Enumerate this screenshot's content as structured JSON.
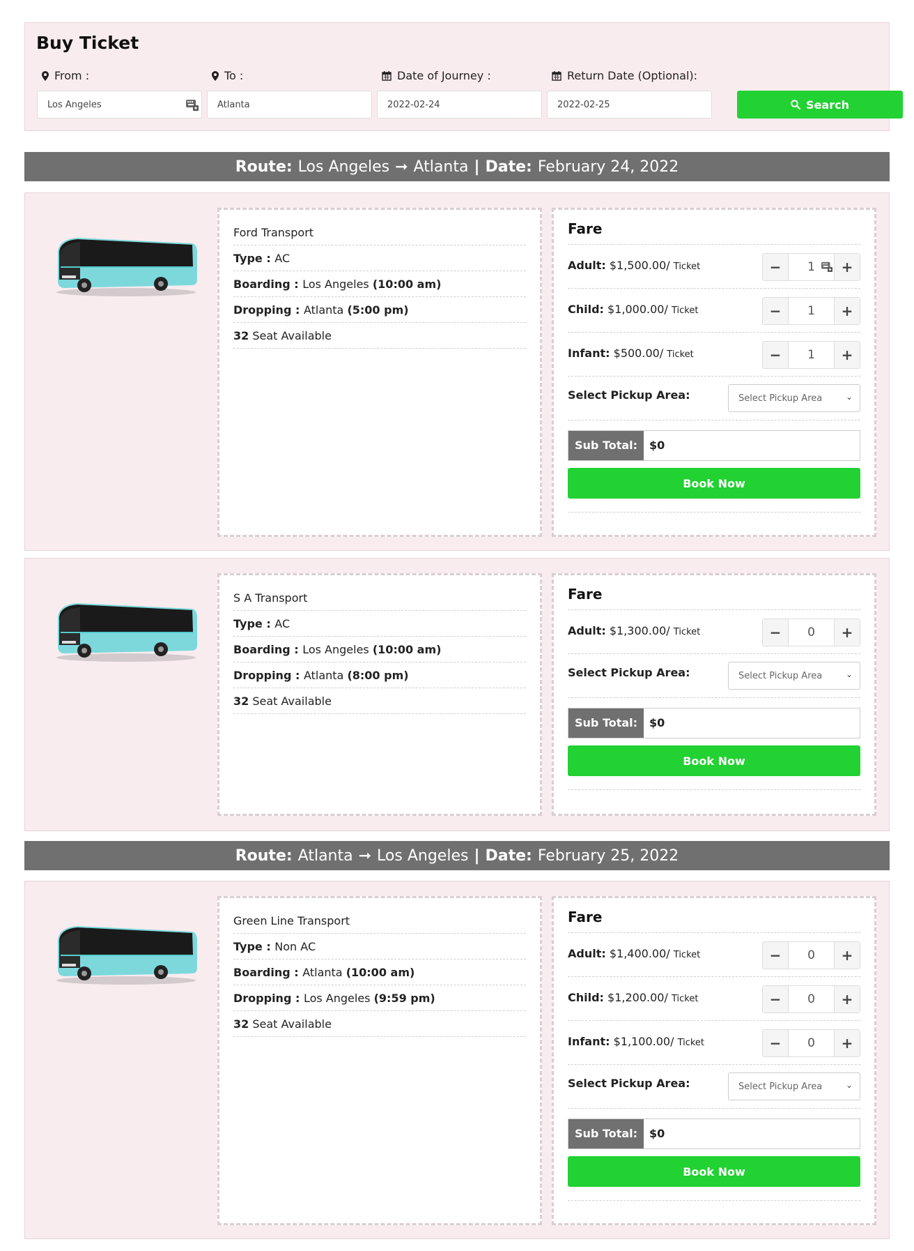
{
  "search": {
    "title": "Buy Ticket",
    "from_label": "From :",
    "to_label": "To :",
    "date_label": "Date of Journey :",
    "return_label": "Return Date (Optional):",
    "from_value": "Los Angeles",
    "to_value": "Atlanta",
    "date_value": "2022-02-24",
    "return_value": "2022-02-25",
    "search_button": "Search"
  },
  "common": {
    "fare_title": "Fare",
    "ticket_unit": "Ticket",
    "pickup_label": "Select Pickup Area:",
    "pickup_placeholder": "Select Pickup Area",
    "subtotal_label": "Sub Total:",
    "book_button": "Book Now",
    "type_key": "Type",
    "boarding_key": "Boarding",
    "dropping_key": "Dropping",
    "seat_suffix": "Seat Available"
  },
  "routes": [
    {
      "route_key": "Route:",
      "from": "Los Angeles",
      "to": "Atlanta",
      "date_key": "Date:",
      "date": "February 24, 2022"
    },
    {
      "route_key": "Route:",
      "from": "Atlanta",
      "to": "Los Angeles",
      "date_key": "Date:",
      "date": "February 25, 2022"
    }
  ],
  "buses": [
    {
      "company": "Ford Transport",
      "type": "AC",
      "boarding_place": "Los Angeles",
      "boarding_time": "(10:00 am)",
      "dropping_place": "Atlanta",
      "dropping_time": "(5:00 pm)",
      "seats": "32",
      "fares": [
        {
          "label": "Adult:",
          "price": "$1,500.00/",
          "qty": "1"
        },
        {
          "label": "Child:",
          "price": "$1,000.00/",
          "qty": "1"
        },
        {
          "label": "Infant:",
          "price": "$500.00/",
          "qty": "1"
        }
      ],
      "subtotal": "$0"
    },
    {
      "company": "S A Transport",
      "type": "AC",
      "boarding_place": "Los Angeles",
      "boarding_time": "(10:00 am)",
      "dropping_place": "Atlanta",
      "dropping_time": "(8:00 pm)",
      "seats": "32",
      "fares": [
        {
          "label": "Adult:",
          "price": "$1,300.00/",
          "qty": "0"
        }
      ],
      "subtotal": "$0"
    },
    {
      "company": "Green Line Transport",
      "type": "Non AC",
      "boarding_place": "Atlanta",
      "boarding_time": "(10:00 am)",
      "dropping_place": "Los Angeles",
      "dropping_time": "(9:59 pm)",
      "seats": "32",
      "fares": [
        {
          "label": "Adult:",
          "price": "$1,400.00/",
          "qty": "0"
        },
        {
          "label": "Child:",
          "price": "$1,200.00/",
          "qty": "0"
        },
        {
          "label": "Infant:",
          "price": "$1,100.00/",
          "qty": "0"
        }
      ],
      "subtotal": "$0"
    }
  ],
  "colors": {
    "accent_green": "#22d132",
    "panel_pink": "#f9ecef",
    "route_bar_gray": "#707070"
  }
}
